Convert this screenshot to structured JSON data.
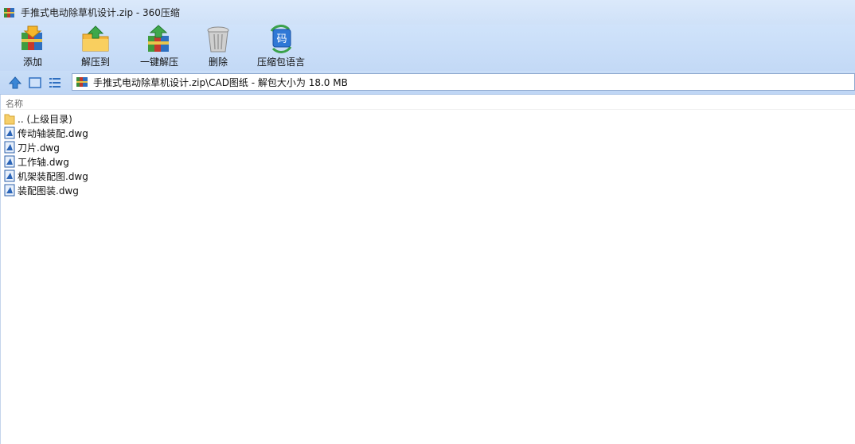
{
  "window": {
    "title": "手推式电动除草机设计.zip - 360压缩"
  },
  "toolbar": {
    "buttons": [
      {
        "label": "添加",
        "icon": "add-books-icon"
      },
      {
        "label": "解压到",
        "icon": "extract-folder-icon"
      },
      {
        "label": "一键解压",
        "icon": "one-click-extract-icon"
      },
      {
        "label": "删除",
        "icon": "trash-can-icon"
      },
      {
        "label": "压缩包语言",
        "icon": "archive-language-icon"
      }
    ]
  },
  "address": {
    "path": "手推式电动除草机设计.zip\\CAD图纸 - 解包大小为 18.0 MB"
  },
  "list": {
    "column_name": "名称",
    "items": [
      {
        "name": ".. (上级目录)",
        "type": "folder"
      },
      {
        "name": "传动轴装配.dwg",
        "type": "dwg"
      },
      {
        "name": "刀片.dwg",
        "type": "dwg"
      },
      {
        "name": "工作轴.dwg",
        "type": "dwg"
      },
      {
        "name": "机架装配图.dwg",
        "type": "dwg"
      },
      {
        "name": "装配图装.dwg",
        "type": "dwg"
      }
    ]
  },
  "colors": {
    "toolbar_bg": "#c3d9f6",
    "accent_blue": "#2a7ad6"
  }
}
